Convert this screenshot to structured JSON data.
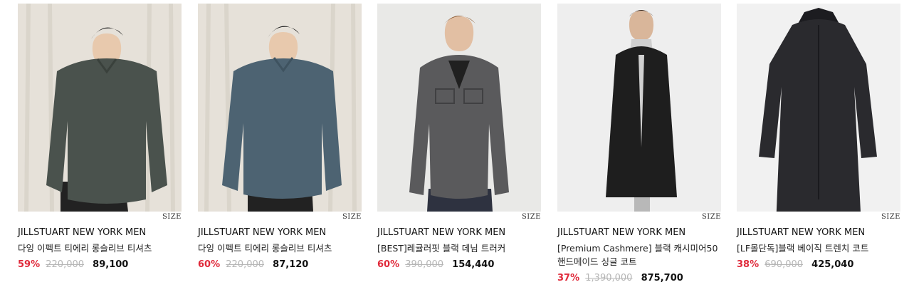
{
  "products": [
    {
      "size_label": "SIZE",
      "brand": "JILLSTUART NEW YORK MEN",
      "name": "다잉 이펙트 티에리 롱슬리브 티셔츠",
      "discount": "59%",
      "original_price": "220,000",
      "sale_price": "89,100",
      "colors": {
        "bg": "#e6e1d9",
        "garment": "#4a524d"
      }
    },
    {
      "size_label": "SIZE",
      "brand": "JILLSTUART NEW YORK MEN",
      "name": "다잉 이펙트 티에리 롱슬리브 티셔츠",
      "discount": "60%",
      "original_price": "220,000",
      "sale_price": "87,120",
      "colors": {
        "bg": "#e6e1d9",
        "garment": "#4d6372"
      }
    },
    {
      "size_label": "SIZE",
      "brand": "JILLSTUART NEW YORK MEN",
      "name": "[BEST]레귤러핏 블랙 데님 트러커",
      "discount": "60%",
      "original_price": "390,000",
      "sale_price": "154,440",
      "colors": {
        "bg": "#e9e9e7",
        "garment": "#5a5a5c"
      }
    },
    {
      "size_label": "SIZE",
      "brand": "JILLSTUART NEW YORK MEN",
      "name": "[Premium Cashmere] 블랙 캐시미어50 핸드메이드 싱글 코트",
      "discount": "37%",
      "original_price": "1,390,000",
      "sale_price": "875,700",
      "colors": {
        "bg": "#eeeeee",
        "garment": "#1e1e1e"
      }
    },
    {
      "size_label": "SIZE",
      "brand": "JILLSTUART NEW YORK MEN",
      "name": "[LF몰단독]블랙 베이직 트렌치 코트",
      "discount": "38%",
      "original_price": "690,000",
      "sale_price": "425,040",
      "colors": {
        "bg": "#f1f1f1",
        "garment": "#2a2a2e"
      }
    }
  ],
  "accent_color": "#e02a3b"
}
